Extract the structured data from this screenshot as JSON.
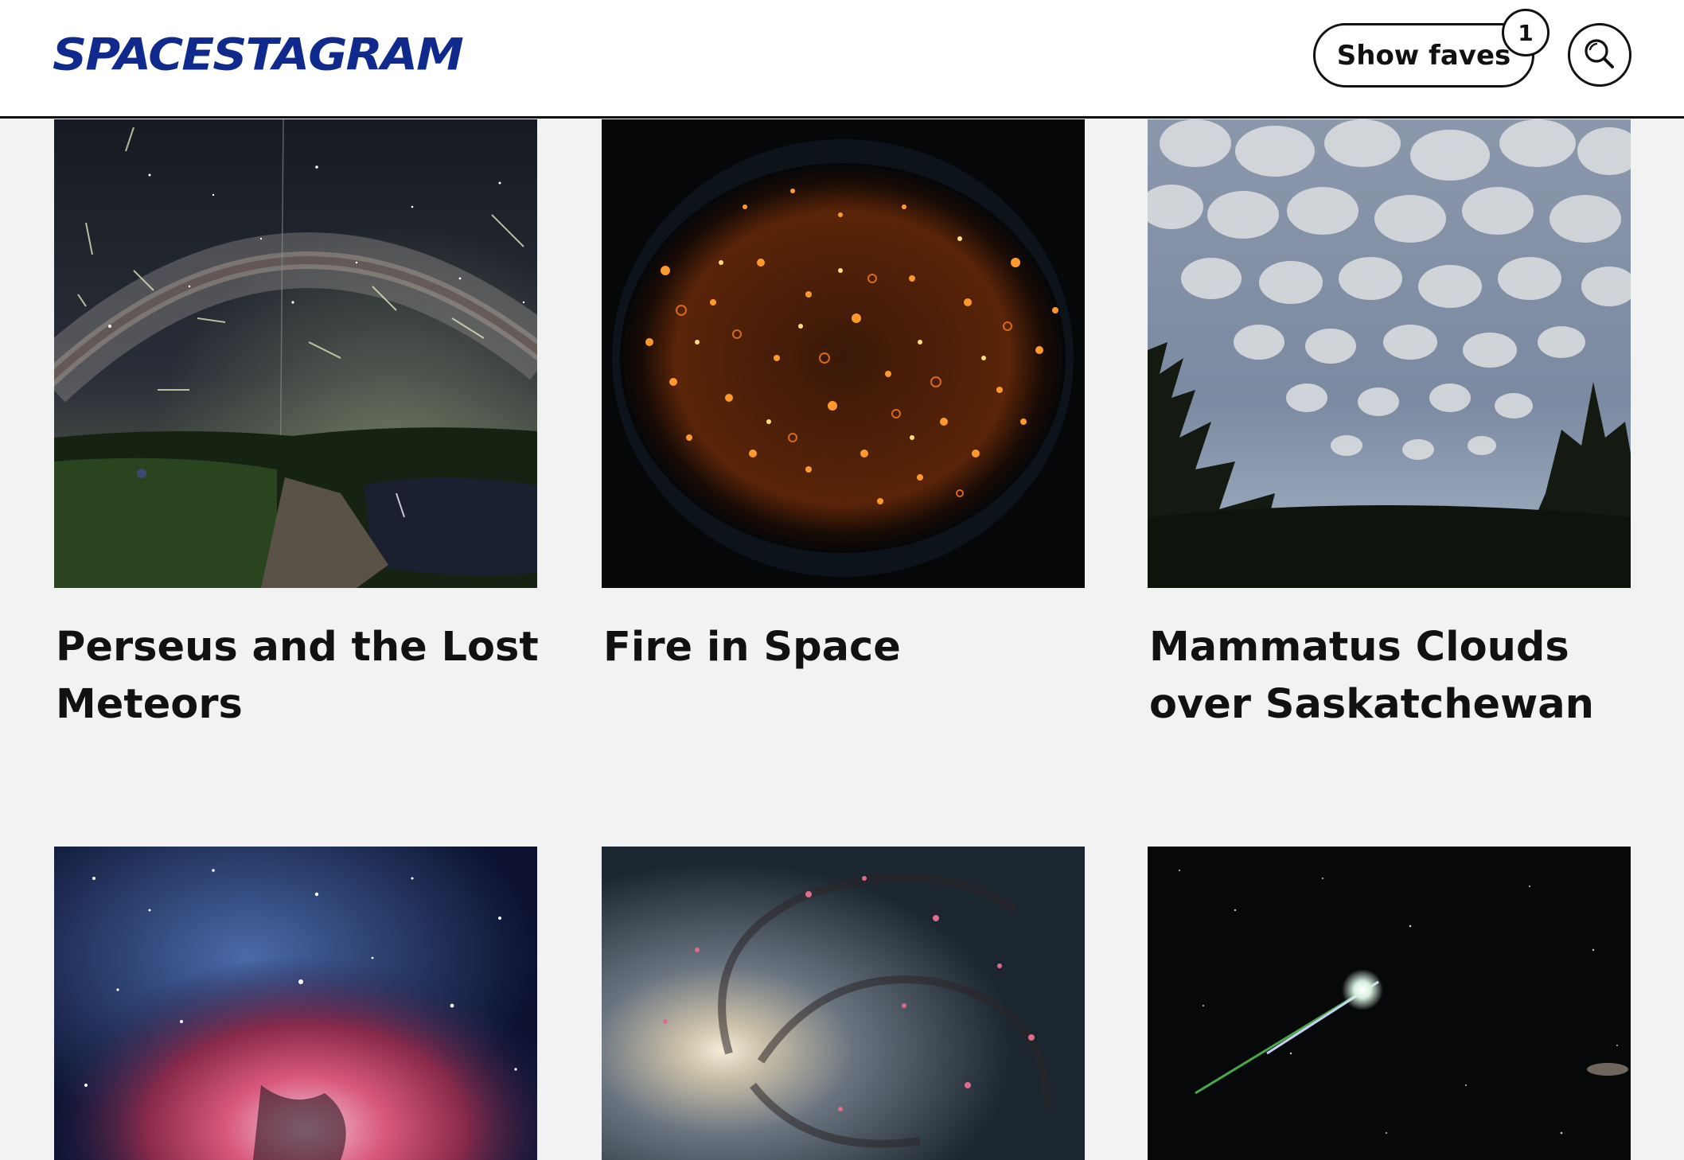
{
  "header": {
    "logo_text": "SPACESTAGRAM",
    "faves_label": "Show faves",
    "faves_count": "1",
    "search_icon": "search-icon"
  },
  "posts": [
    {
      "title": "Perseus and the Lost Meteors"
    },
    {
      "title": "Fire in Space"
    },
    {
      "title": "Mammatus Clouds over Saskatchewan"
    },
    {
      "title": ""
    },
    {
      "title": ""
    },
    {
      "title": ""
    }
  ],
  "colors": {
    "brand": "#0f2a8c",
    "background": "#f2f2f2",
    "text": "#111111"
  }
}
